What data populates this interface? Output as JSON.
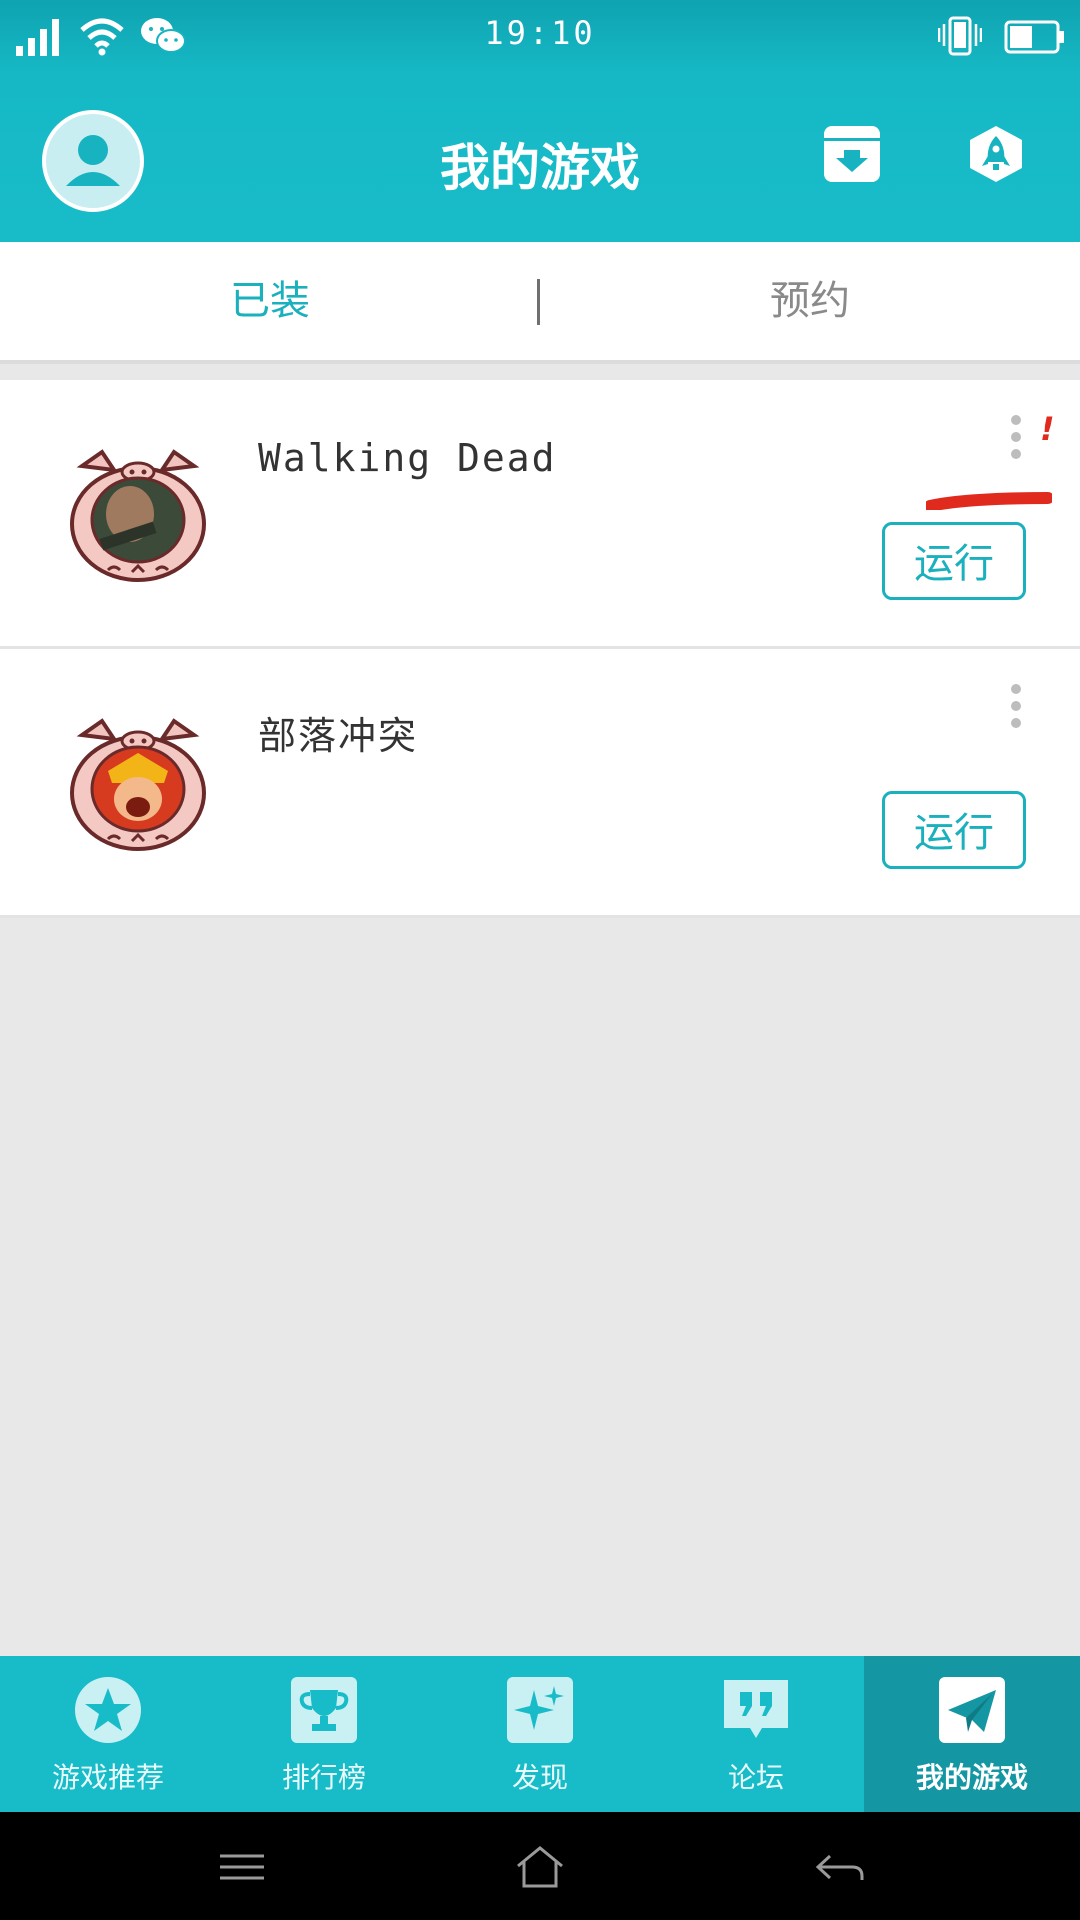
{
  "status_bar": {
    "time": "19:10"
  },
  "header": {
    "title": "我的游戏"
  },
  "tabs": [
    {
      "label": "已装"
    },
    {
      "label": "预约"
    }
  ],
  "games": [
    {
      "name": "Walking Dead",
      "action": "运行",
      "annotation": "!"
    },
    {
      "name": "部落冲突",
      "action": "运行"
    }
  ],
  "bottom_nav": [
    {
      "label": "游戏推荐",
      "icon": "star-icon"
    },
    {
      "label": "排行榜",
      "icon": "trophy-icon"
    },
    {
      "label": "发现",
      "icon": "sparkle-icon"
    },
    {
      "label": "论坛",
      "icon": "quote-icon"
    },
    {
      "label": "我的游戏",
      "icon": "paper-plane-icon",
      "active": true
    }
  ],
  "colors": {
    "accent": "#18bcc8",
    "accent_dark": "#1497a2",
    "tab_active": "#1ab0bd",
    "annotation_red": "#e02a1e"
  }
}
